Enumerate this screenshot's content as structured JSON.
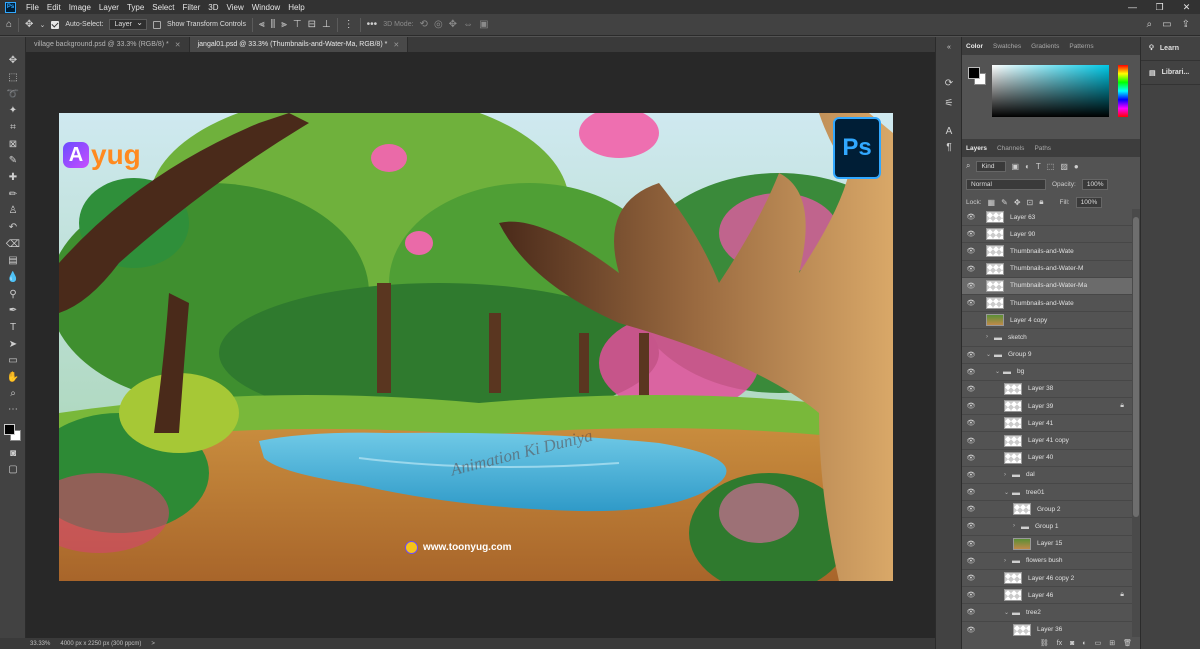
{
  "menu": {
    "items": [
      "File",
      "Edit",
      "Image",
      "Layer",
      "Type",
      "Select",
      "Filter",
      "3D",
      "View",
      "Window",
      "Help"
    ],
    "window_controls": [
      "—",
      "❐",
      "✕"
    ]
  },
  "options_bar": {
    "auto_select_label": "Auto-Select:",
    "auto_select_value": "Layer",
    "show_transform_label": "Show Transform Controls",
    "mode_3d_label": "3D Mode:",
    "more": "•••"
  },
  "tabs": [
    {
      "title": "village background.psd @ 33.3% (RGB/8) *",
      "close": "✕"
    },
    {
      "title": "jangal01.psd @ 33.3% (Thumbnails-and-Water-Ma, RGB/8) *",
      "close": "✕"
    }
  ],
  "artwork": {
    "logo_letter": "A",
    "logo_text": "yug",
    "ps_badge": "Ps",
    "watermark": "Animation Ki Duniya",
    "website": "www.toonyug.com"
  },
  "status": {
    "zoom": "33.33%",
    "dimensions": "4000 px x 2250 px (300 ppcm)",
    "arrow": ">"
  },
  "color_panel": {
    "tabs": [
      "Color",
      "Swatches",
      "Gradients",
      "Patterns"
    ],
    "fg_color": "#000000",
    "bg_color": "#ffffff"
  },
  "layers_panel": {
    "tabs": [
      "Layers",
      "Channels",
      "Paths"
    ],
    "kind_label": "Kind",
    "blend_mode": "Normal",
    "opacity_label": "Opacity:",
    "opacity_value": "100%",
    "lock_label": "Lock:",
    "fill_label": "Fill:",
    "fill_value": "100%",
    "layers": [
      {
        "name": "Layer 63",
        "type": "layer",
        "indent": 0,
        "visible": true
      },
      {
        "name": "Layer 90",
        "type": "layer",
        "indent": 0,
        "visible": true
      },
      {
        "name": "Thumbnails-and-Wate",
        "type": "smart",
        "indent": 0,
        "visible": true
      },
      {
        "name": "Thumbnails-and-Water-M",
        "type": "smart",
        "indent": 0,
        "visible": true
      },
      {
        "name": "Thumbnails-and-Water-Ma",
        "type": "smart",
        "indent": 0,
        "visible": true,
        "selected": true
      },
      {
        "name": "Thumbnails-and-Wate",
        "type": "smart",
        "indent": 0,
        "visible": true
      },
      {
        "name": "Layer 4 copy",
        "type": "art",
        "indent": 0,
        "visible": false
      },
      {
        "name": "sketch",
        "type": "group",
        "indent": 0,
        "visible": false,
        "expanded": false
      },
      {
        "name": "Group 9",
        "type": "group",
        "indent": 0,
        "visible": true,
        "expanded": true
      },
      {
        "name": "bg",
        "type": "group",
        "indent": 1,
        "visible": true,
        "expanded": true
      },
      {
        "name": "Layer 38",
        "type": "layer",
        "indent": 2,
        "visible": true
      },
      {
        "name": "Layer 39",
        "type": "layer",
        "indent": 2,
        "visible": true,
        "locked": true
      },
      {
        "name": "Layer 41",
        "type": "layer",
        "indent": 2,
        "visible": true
      },
      {
        "name": "Layer 41 copy",
        "type": "layer",
        "indent": 2,
        "visible": true
      },
      {
        "name": "Layer 40",
        "type": "layer",
        "indent": 2,
        "visible": true
      },
      {
        "name": "dal",
        "type": "group",
        "indent": 2,
        "visible": true,
        "expanded": false
      },
      {
        "name": "tree01",
        "type": "group",
        "indent": 2,
        "visible": true,
        "expanded": true
      },
      {
        "name": "Group 2",
        "type": "layer",
        "indent": 3,
        "visible": true
      },
      {
        "name": "Group 1",
        "type": "group",
        "indent": 3,
        "visible": true,
        "expanded": false
      },
      {
        "name": "Layer 15",
        "type": "art",
        "indent": 3,
        "visible": true
      },
      {
        "name": "flowers bush",
        "type": "group",
        "indent": 2,
        "visible": true,
        "expanded": false
      },
      {
        "name": "Layer 46 copy 2",
        "type": "layer",
        "indent": 2,
        "visible": true
      },
      {
        "name": "Layer 46",
        "type": "layer",
        "indent": 2,
        "visible": true,
        "locked": true
      },
      {
        "name": "tree2",
        "type": "group",
        "indent": 2,
        "visible": true,
        "expanded": true
      },
      {
        "name": "Layer 36",
        "type": "layer",
        "indent": 3,
        "visible": true
      }
    ]
  },
  "right_dock": {
    "learn": "Learn",
    "libraries": "Librari..."
  }
}
